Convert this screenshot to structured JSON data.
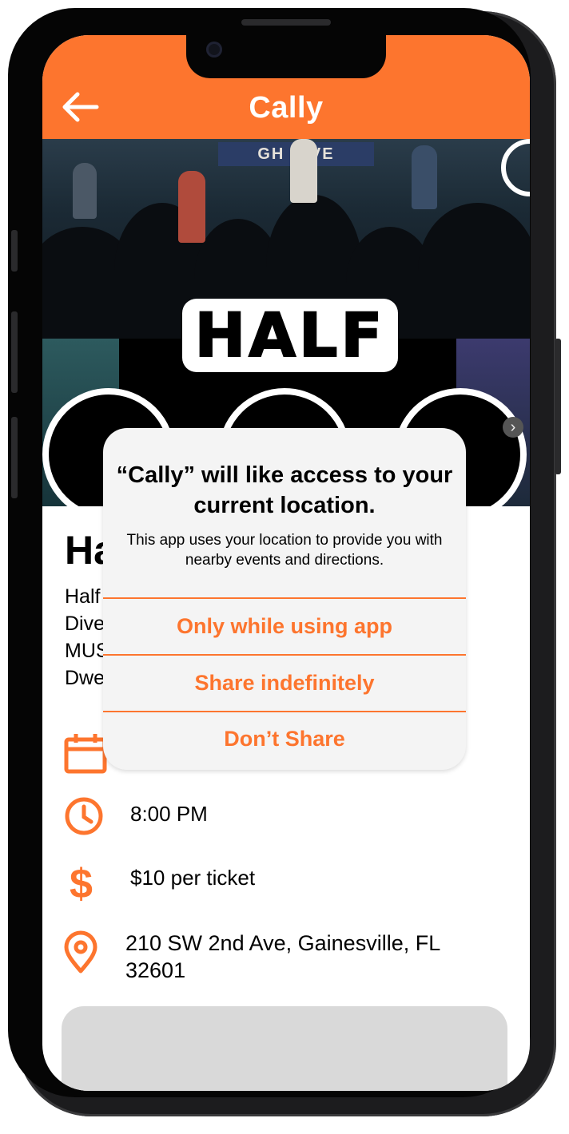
{
  "app": {
    "title": "Cally",
    "accent_color": "#fd752e",
    "back_icon": "arrow-left-icon"
  },
  "hero": {
    "banner_text": "GH DIVE",
    "logo_text": "HALF",
    "next_icon": "chevron-right-icon"
  },
  "event": {
    "title": "Ha",
    "description_lines": [
      "Half",
      "Dive",
      "MUS",
      "Dwe"
    ],
    "date_icon": "calendar-icon",
    "time_icon": "clock-icon",
    "time": "8:00 PM",
    "price_icon": "dollar-icon",
    "price": "$10 per ticket",
    "location_icon": "map-pin-icon",
    "address": "210 SW 2nd Ave, Gainesville, FL 32601"
  },
  "location_dialog": {
    "title": "“Cally” will like access to your current location.",
    "message": "This app uses your location to provide you with nearby events and directions.",
    "options": [
      "Only while using app",
      "Share indefinitely",
      "Don’t Share"
    ]
  }
}
